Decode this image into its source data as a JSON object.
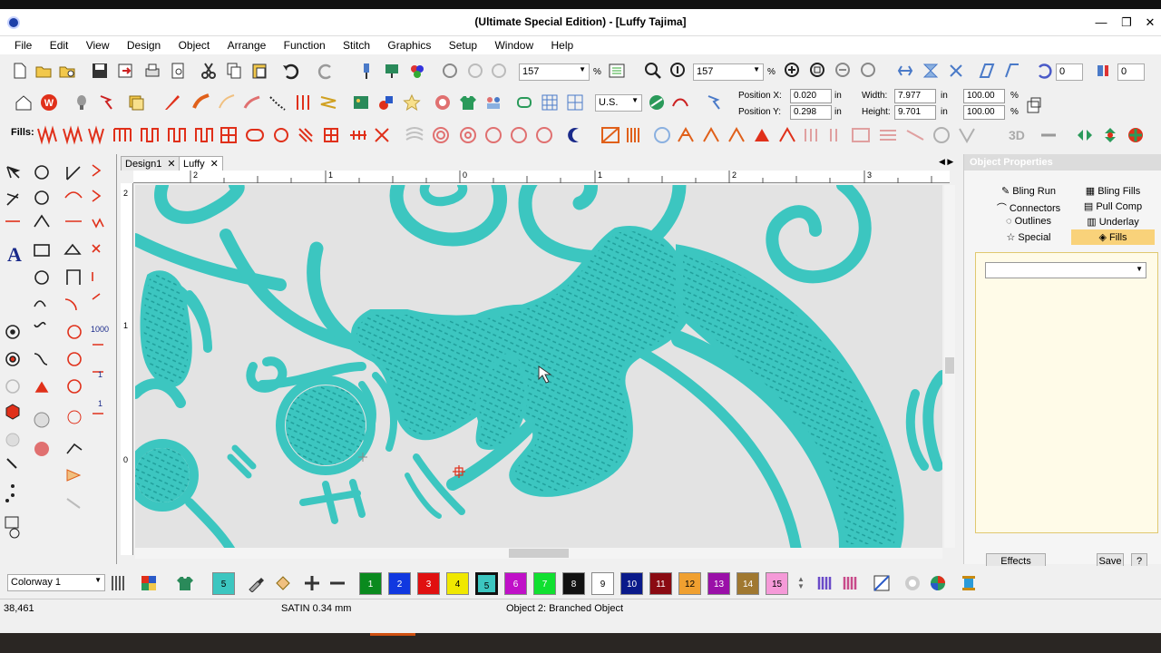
{
  "window": {
    "title": "(Ultimate Special Edition) - [Luffy     Tajima]",
    "controls": [
      "—",
      "❐",
      "✕"
    ]
  },
  "menu": [
    "File",
    "Edit",
    "View",
    "Design",
    "Object",
    "Arrange",
    "Function",
    "Stitch",
    "Graphics",
    "Setup",
    "Window",
    "Help"
  ],
  "toolbar1": {
    "zoom1": "157",
    "zoom2": "157",
    "pct": "%",
    "count1": "0",
    "count2": "0"
  },
  "toolbar2": {
    "units": "U.S.",
    "pos_x_label": "Position X:",
    "pos_x": "0.020",
    "pos_y_label": "Position Y:",
    "pos_y": "0.298",
    "width_label": "Width:",
    "width": "7.977",
    "height_label": "Height:",
    "height": "9.701",
    "in": "in",
    "scale_w": "100.00",
    "scale_h": "100.00",
    "pct": "%"
  },
  "fillsbar": {
    "label": "Fills:",
    "threed": "3D"
  },
  "doc_tabs": [
    {
      "label": "Design1",
      "close": "✕"
    },
    {
      "label": "Luffy",
      "close": "✕"
    }
  ],
  "ruler": {
    "h_ticks": [
      "2",
      "1",
      "0",
      "1",
      "2",
      "3"
    ],
    "v_ticks": [
      "2",
      "1",
      "0"
    ]
  },
  "left_tools_text": {
    "thousand": "1000",
    "one_a": "1",
    "one_b": "1",
    "letter_a": "A"
  },
  "object_properties": {
    "title": "Object Properties",
    "tabs": [
      {
        "label": "Bling Run",
        "icon": "bling-run-icon"
      },
      {
        "label": "Bling Fills",
        "icon": "bling-fills-icon"
      },
      {
        "label": "Connectors",
        "icon": "connectors-icon"
      },
      {
        "label": "Pull Comp",
        "icon": "pull-comp-icon"
      },
      {
        "label": "Outlines",
        "icon": "outlines-icon"
      },
      {
        "label": "Underlay",
        "icon": "underlay-icon"
      },
      {
        "label": "Special",
        "icon": "star-icon"
      },
      {
        "label": "Fills",
        "icon": "fills-icon"
      }
    ],
    "effects": "Effects",
    "save": "Save",
    "help": "?"
  },
  "colorway": {
    "label": "Colorway 1",
    "current": "5"
  },
  "swatches": [
    {
      "n": "1",
      "color": "#0a8a1e"
    },
    {
      "n": "2",
      "color": "#1038e0"
    },
    {
      "n": "3",
      "color": "#e01010"
    },
    {
      "n": "4",
      "color": "#f0e800"
    },
    {
      "n": "5",
      "color": "#3cc6c0"
    },
    {
      "n": "6",
      "color": "#c010c8"
    },
    {
      "n": "7",
      "color": "#10e030"
    },
    {
      "n": "8",
      "color": "#111111"
    },
    {
      "n": "9",
      "color": "#ffffff"
    },
    {
      "n": "10",
      "color": "#0a1a8a"
    },
    {
      "n": "11",
      "color": "#8a0a12"
    },
    {
      "n": "12",
      "color": "#f0a030"
    },
    {
      "n": "13",
      "color": "#9a10a8"
    },
    {
      "n": "14",
      "color": "#a07830"
    },
    {
      "n": "15",
      "color": "#f59ad8"
    }
  ],
  "status": {
    "coords": "38,461",
    "stitch": "SATIN  0.34 mm",
    "object": "Object 2: Branched Object"
  },
  "colors": {
    "thread": "#3cc6c0",
    "thread_dark": "#1d9c98",
    "accent_red": "#e0301a"
  }
}
